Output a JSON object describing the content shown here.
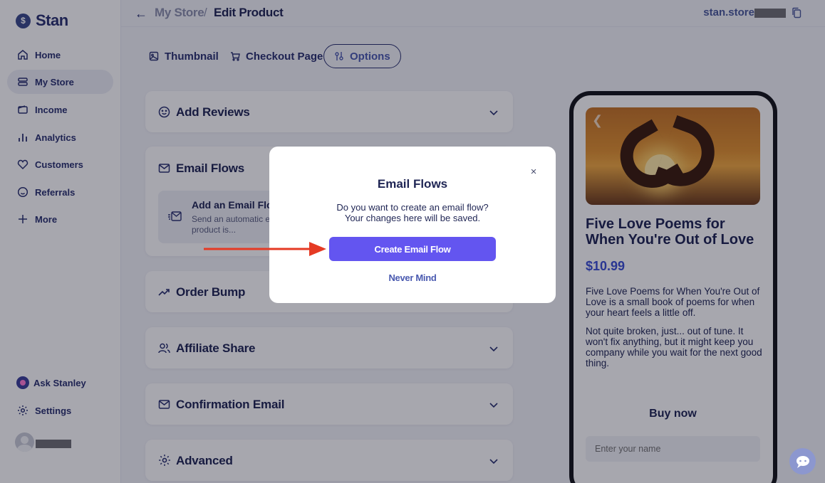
{
  "brand": {
    "name": "Stan",
    "logo_symbol": "$"
  },
  "sidebar": {
    "items": [
      {
        "label": "Home",
        "icon": "home-icon"
      },
      {
        "label": "My Store",
        "icon": "store-icon",
        "active": true
      },
      {
        "label": "Income",
        "icon": "wallet-icon"
      },
      {
        "label": "Analytics",
        "icon": "analytics-icon"
      },
      {
        "label": "Customers",
        "icon": "heart-icon"
      },
      {
        "label": "Referrals",
        "icon": "smile-icon"
      },
      {
        "label": "More",
        "icon": "plus-icon"
      }
    ],
    "bottom": [
      {
        "label": "Ask Stanley",
        "icon": "stanley-icon"
      },
      {
        "label": "Settings",
        "icon": "gear-icon"
      }
    ]
  },
  "topbar": {
    "breadcrumb_store": "My Store",
    "breadcrumb_sep": "/",
    "breadcrumb_page": "Edit Product",
    "store_url": "stan.store"
  },
  "tabs": [
    {
      "label": "Thumbnail",
      "icon": "image-icon"
    },
    {
      "label": "Checkout Page",
      "icon": "cart-icon"
    },
    {
      "label": "Options",
      "icon": "options-icon",
      "active": true
    }
  ],
  "sections": {
    "add_reviews": "Add Reviews",
    "email_flows": "Email Flows",
    "email_flow_card_title": "Add an Email Flow",
    "email_flow_card_desc": "Send an automatic e... when this product is...",
    "order_bump": "Order Bump",
    "affiliate_share": "Affiliate Share",
    "confirmation_email": "Confirmation Email",
    "advanced": "Advanced"
  },
  "preview": {
    "title": "Five Love Poems for When You're Out of Love",
    "price": "$10.99",
    "para1": "Five Love Poems for When You're Out of Love is a small book of poems for when your heart feels a little off.",
    "para2": "Not quite broken, just... out of tune. It won't fix anything, but it might keep you company while you wait for the next good thing.",
    "buy_label": "Buy now",
    "name_placeholder": "Enter your name"
  },
  "modal": {
    "title": "Email Flows",
    "text": "Do you want to create an email flow? Your changes here will be saved.",
    "primary_label": "Create Email Flow",
    "secondary_label": "Never Mind",
    "close_symbol": "×"
  },
  "colors": {
    "accent": "#6355f0",
    "brand_navy": "#2a3170",
    "annotation_arrow": "#e53a24"
  }
}
